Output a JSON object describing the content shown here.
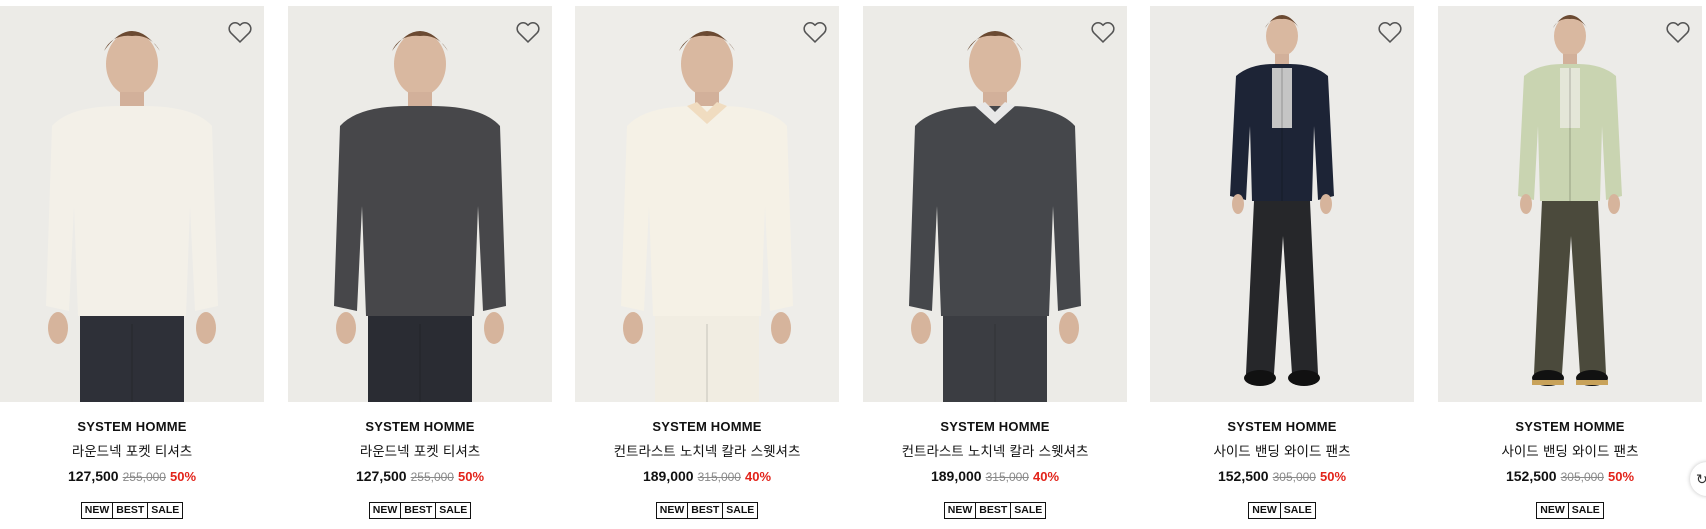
{
  "products": [
    {
      "brand": "SYSTEM HOMME",
      "name": "라운드넥 포켓 티셔츠",
      "price": "127,500",
      "original_price": "255,000",
      "discount": "50%",
      "tags": [
        "NEW",
        "BEST",
        "SALE"
      ],
      "top_color": "#f3f0e8",
      "bottom_color": "#2e3038",
      "bg_color": "#ecebe7"
    },
    {
      "brand": "SYSTEM HOMME",
      "name": "라운드넥 포켓 티셔츠",
      "price": "127,500",
      "original_price": "255,000",
      "discount": "50%",
      "tags": [
        "NEW",
        "BEST",
        "SALE"
      ],
      "top_color": "#47474a",
      "bottom_color": "#2a2c33",
      "bg_color": "#ecebe7"
    },
    {
      "brand": "SYSTEM HOMME",
      "name": "컨트라스트 노치넥 칼라 스웻셔츠",
      "price": "189,000",
      "original_price": "315,000",
      "discount": "40%",
      "tags": [
        "NEW",
        "BEST",
        "SALE"
      ],
      "top_color": "#f5f1e6",
      "bottom_color": "#f1ede2",
      "bg_color": "#eeede9"
    },
    {
      "brand": "SYSTEM HOMME",
      "name": "컨트라스트 노치넥 칼라 스웻셔츠",
      "price": "189,000",
      "original_price": "315,000",
      "discount": "40%",
      "tags": [
        "NEW",
        "BEST",
        "SALE"
      ],
      "top_color": "#45474b",
      "bottom_color": "#3b3d42",
      "bg_color": "#ecebe7"
    },
    {
      "brand": "SYSTEM HOMME",
      "name": "사이드 밴딩 와이드 팬츠",
      "price": "152,500",
      "original_price": "305,000",
      "discount": "50%",
      "tags": [
        "NEW",
        "SALE"
      ],
      "top_color": "#1d2436",
      "bottom_color": "#26272a",
      "bg_color": "#ecebe8"
    },
    {
      "brand": "SYSTEM HOMME",
      "name": "사이드 밴딩 와이드 팬츠",
      "price": "152,500",
      "original_price": "305,000",
      "discount": "50%",
      "tags": [
        "NEW",
        "SALE"
      ],
      "top_color": "#c9d4b1",
      "bottom_color": "#4b4a3c",
      "bg_color": "#ecebe8"
    }
  ],
  "icons": {
    "wishlist": "heart-outline-icon",
    "floating": "refresh-icon"
  },
  "floating_glyph": "↻"
}
